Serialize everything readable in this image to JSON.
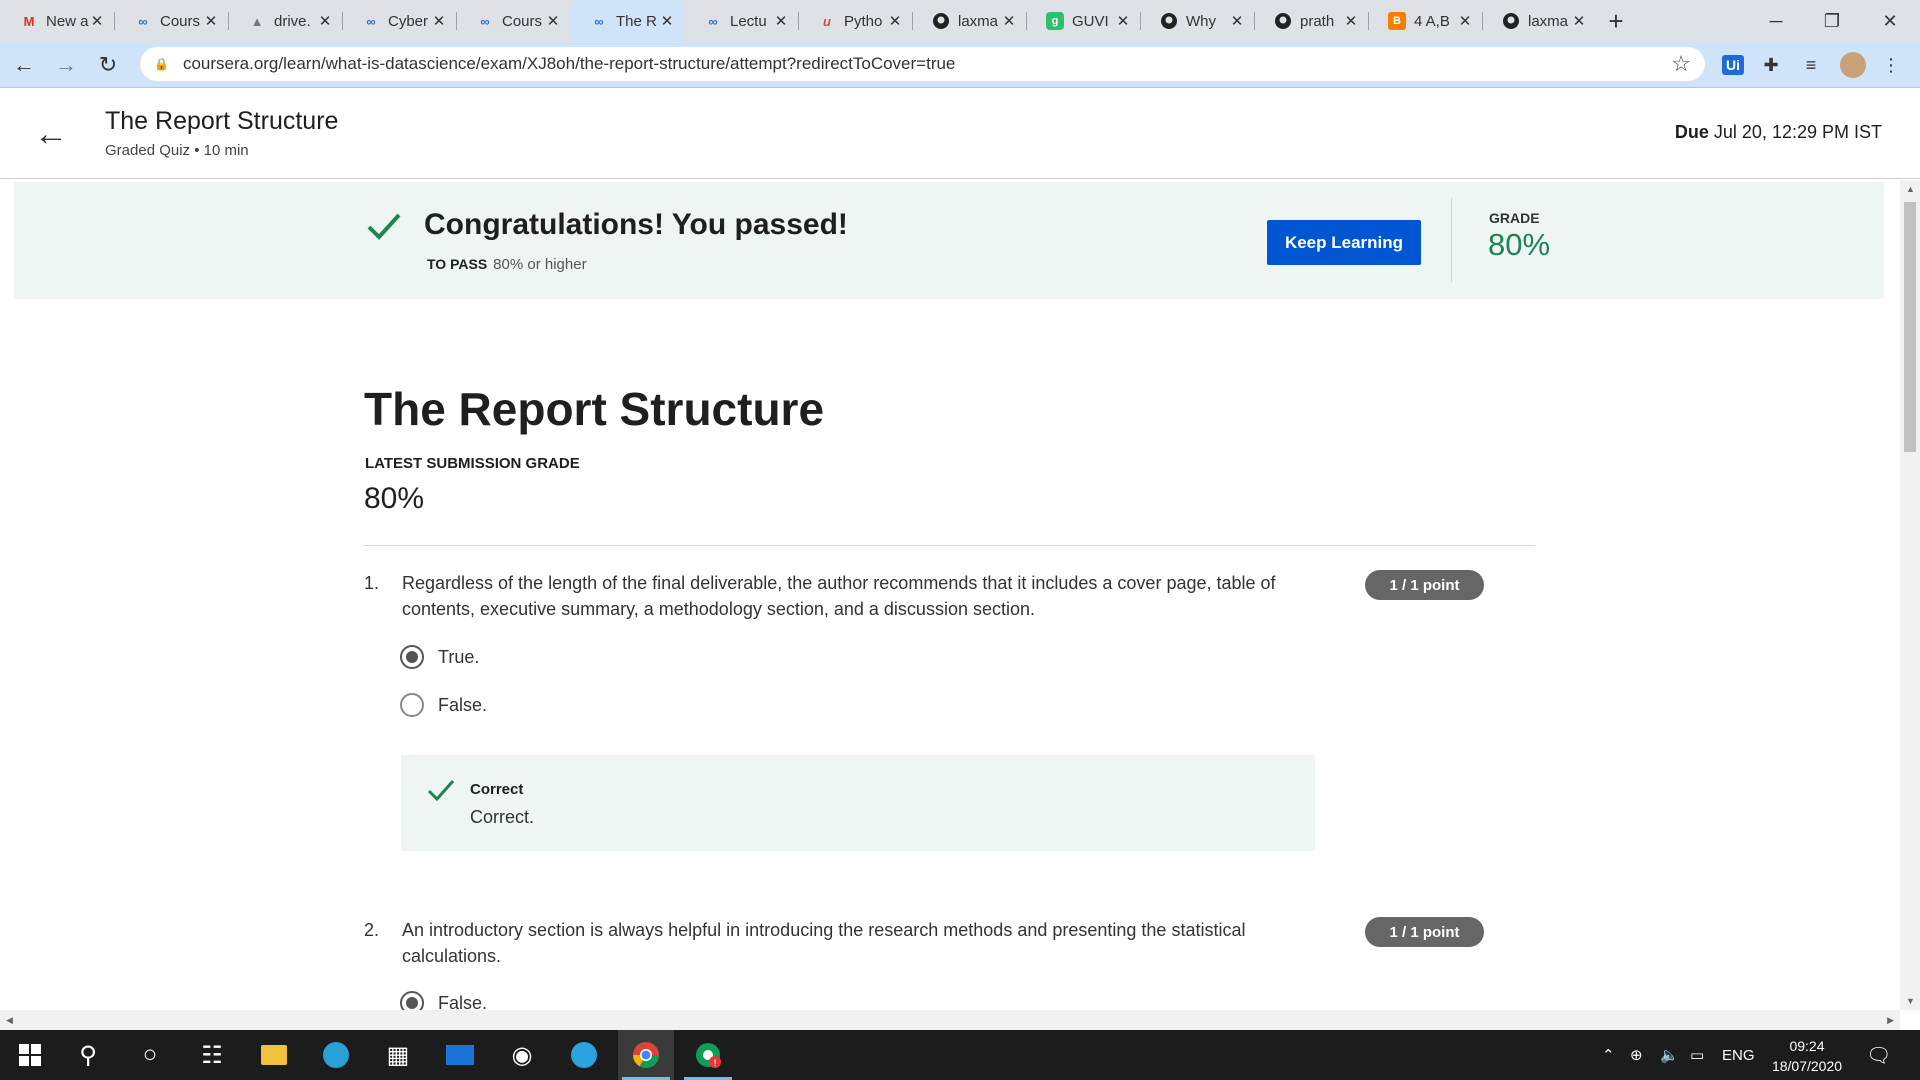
{
  "browser": {
    "tabs": [
      {
        "title": "New a",
        "icon": "gmail-icon",
        "active": false
      },
      {
        "title": "Cours",
        "icon": "coursera-icon",
        "active": false
      },
      {
        "title": "drive.",
        "icon": "drive-icon",
        "active": false
      },
      {
        "title": "Cyber",
        "icon": "coursera-icon",
        "active": false
      },
      {
        "title": "Cours",
        "icon": "coursera-icon",
        "active": false
      },
      {
        "title": "The R",
        "icon": "coursera-icon",
        "active": true
      },
      {
        "title": "Lectu",
        "icon": "coursera-icon",
        "active": false
      },
      {
        "title": "Pytho",
        "icon": "udemy-icon",
        "active": false
      },
      {
        "title": "laxma",
        "icon": "github-icon",
        "active": false
      },
      {
        "title": "GUVI",
        "icon": "guvi-icon",
        "active": false
      },
      {
        "title": "Why",
        "icon": "github-icon",
        "active": false
      },
      {
        "title": "prath",
        "icon": "github-icon",
        "active": false
      },
      {
        "title": "4 A,B",
        "icon": "blogger-icon",
        "active": false
      },
      {
        "title": "laxma",
        "icon": "github-icon",
        "active": false
      }
    ],
    "url": "coursera.org/learn/what-is-datascience/exam/XJ8oh/the-report-structure/attempt?redirectToCover=true"
  },
  "header": {
    "title": "The Report Structure",
    "subtitle": "Graded Quiz • 10 min",
    "due_label": "Due",
    "due_value": "Jul 20, 12:29 PM IST"
  },
  "banner": {
    "headline": "Congratulations! You passed!",
    "to_pass_label": "TO PASS",
    "to_pass_value": "80% or higher",
    "button_label": "Keep Learning",
    "grade_label": "GRADE",
    "grade_value": "80%"
  },
  "main": {
    "title": "The Report Structure",
    "latest_label": "LATEST SUBMISSION GRADE",
    "latest_value": "80%",
    "questions": [
      {
        "num": "1.",
        "text": "Regardless of the length of the final deliverable, the author recommends that it includes a cover page, table of contents, executive summary, a methodology section, and a discussion section.",
        "points": "1 / 1 point",
        "options": [
          {
            "label": "True.",
            "selected": true
          },
          {
            "label": "False.",
            "selected": false
          }
        ],
        "feedback_label": "Correct",
        "feedback_text": "Correct."
      },
      {
        "num": "2.",
        "text": "An introductory section is always helpful in introducing the research methods and presenting the statistical calculations.",
        "points": "1 / 1 point",
        "options": [
          {
            "label": "False.",
            "selected": true
          }
        ]
      }
    ]
  },
  "taskbar": {
    "lang": "ENG",
    "time": "09:24",
    "date": "18/07/2020"
  },
  "colors": {
    "accent": "#0056d2",
    "success": "#1f8354",
    "banner_bg": "#eef5f3"
  }
}
